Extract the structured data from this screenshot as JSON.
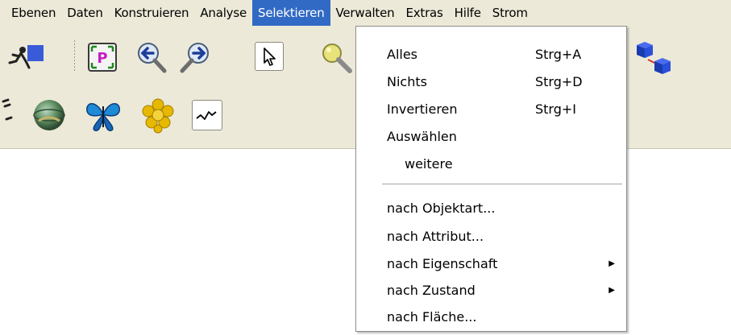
{
  "menubar": {
    "items": [
      {
        "label": "Ebenen"
      },
      {
        "label": "Daten"
      },
      {
        "label": "Konstruieren"
      },
      {
        "label": "Analyse"
      },
      {
        "label": "Selektieren",
        "active": true
      },
      {
        "label": "Verwalten"
      },
      {
        "label": "Extras"
      },
      {
        "label": "Hilfe"
      },
      {
        "label": "Strom"
      }
    ],
    "active_color": "#316ac5",
    "background": "#ece9d8"
  },
  "toolbar": {
    "icons": [
      "runner-icon",
      "zoom-extent-icon",
      "zoom-back-icon",
      "zoom-forward-icon",
      "select-arrow-icon",
      "magnifier-icon",
      "cubes-icon",
      "pen-icon",
      "globe-icon",
      "butterfly-icon",
      "flower-icon",
      "graph-curve-icon"
    ]
  },
  "selektieren_menu": {
    "items": [
      {
        "label": "Alles",
        "shortcut": "Strg+A"
      },
      {
        "label": "Nichts",
        "shortcut": "Strg+D"
      },
      {
        "label": "Invertieren",
        "shortcut": "Strg+I"
      },
      {
        "label": "Auswählen"
      },
      {
        "label": "weitere"
      },
      {
        "label": "nach Objektart..."
      },
      {
        "label": "nach Attribut..."
      },
      {
        "label": "nach Eigenschaft",
        "submenu": true
      },
      {
        "label": "nach Zustand",
        "submenu": true
      },
      {
        "label": "nach Fläche..."
      }
    ]
  }
}
